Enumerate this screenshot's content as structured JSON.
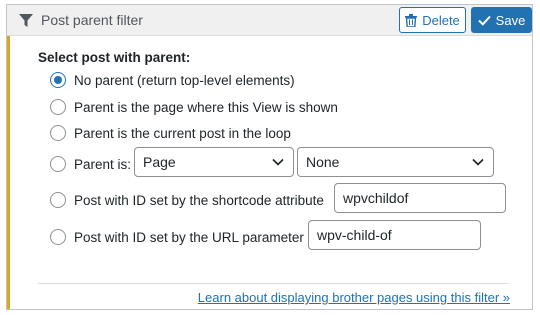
{
  "header": {
    "title": "Post parent filter",
    "delete_label": "Delete",
    "save_label": "Save",
    "accent_color": "#2271b1"
  },
  "section_label": "Select post with parent:",
  "options": [
    {
      "label": "No parent (return top-level elements)",
      "checked": true
    },
    {
      "label": "Parent is the page where this View is shown",
      "checked": false
    },
    {
      "label": "Parent is the current post in the loop",
      "checked": false
    },
    {
      "label": "Parent is:",
      "checked": false
    },
    {
      "label": "Post with ID set by the shortcode attribute",
      "checked": false
    },
    {
      "label": "Post with ID set by the URL parameter",
      "checked": false
    }
  ],
  "parent_type_select": {
    "value": "Page"
  },
  "parent_item_select": {
    "value": "None"
  },
  "shortcode_attribute_input": {
    "value": "wpvchildof"
  },
  "url_parameter_input": {
    "value": "wpv-child-of"
  },
  "footer": {
    "learn_link": "Learn about displaying brother pages using this filter »"
  },
  "icons": [
    "filter-icon",
    "trash-icon",
    "checkmark-icon",
    "chevron-down-icon",
    "radio-icon"
  ]
}
